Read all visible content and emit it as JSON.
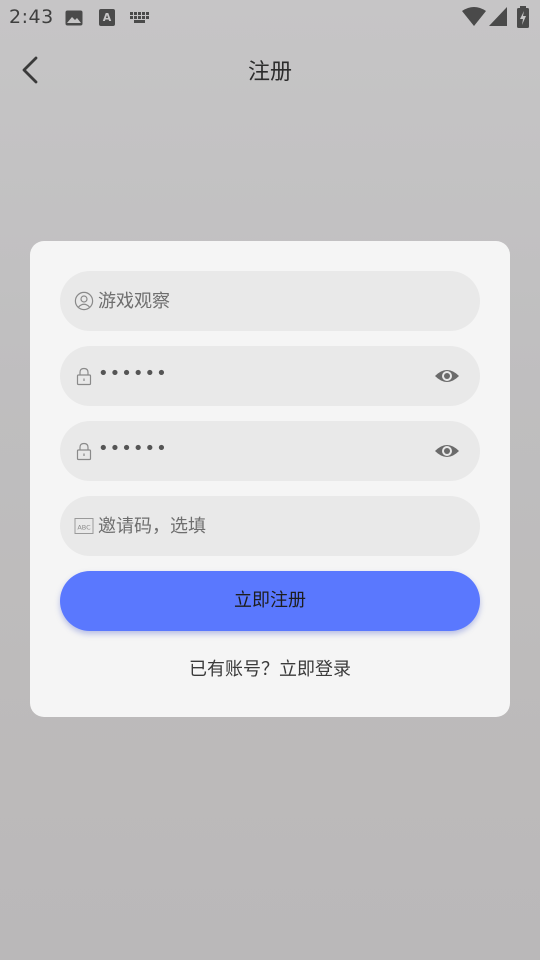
{
  "status_bar": {
    "time": "2:43",
    "icons": [
      "image-icon",
      "text-a-icon",
      "keyboard-icon",
      "wifi-icon",
      "cell-signal-icon",
      "battery-charging-icon"
    ]
  },
  "header": {
    "title": "注册",
    "back_icon": "chevron-left-icon"
  },
  "form": {
    "username": {
      "placeholder": "游戏观察",
      "icon": "user-icon"
    },
    "password": {
      "value": "••••••",
      "icon": "lock-icon",
      "toggle_icon": "eye-icon"
    },
    "confirm_password": {
      "value": "••••••",
      "icon": "lock-icon",
      "toggle_icon": "eye-icon"
    },
    "invite_code": {
      "placeholder": "邀请码，选填",
      "icon": "abc-icon"
    },
    "submit_label": "立即注册",
    "login_link": "已有账号？立即登录"
  },
  "colors": {
    "accent": "#5a78fe",
    "card": "#f5f5f5",
    "field": "#e9e9e9"
  }
}
